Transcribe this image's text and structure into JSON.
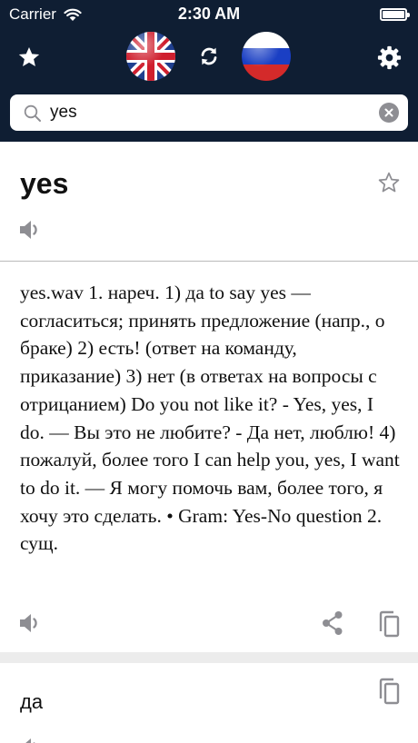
{
  "status_bar": {
    "carrier": "Carrier",
    "time": "2:30 AM"
  },
  "toolbar": {
    "favorites_icon": "star-icon",
    "source_language_flag": "uk-flag",
    "swap_icon": "swap-icon",
    "target_language_flag": "russia-flag",
    "settings_icon": "gear-icon"
  },
  "search": {
    "value": "yes"
  },
  "entry": {
    "headword": "yes",
    "definition": "yes.wav 1. нареч. 1) да to say yes — согласиться; принять предложение (напр., о браке) 2) есть! (ответ на команду, приказание) 3) нет (в ответах на вопросы с отрицанием) Do you not like it? - Yes, yes, I do. — Вы это не любите? - Да нет, люблю! 4) пожалуй, более того I can help you, yes, I want to do it. — Я могу помочь вам, более того, я хочу это сделать. • Gram: Yes-No question 2. сущ."
  },
  "translation": {
    "text": "да"
  },
  "colors": {
    "header_bg": "#0f1e33",
    "icon_gray": "#8e8e93",
    "divider": "#b9b9b9",
    "band": "#ececec"
  }
}
